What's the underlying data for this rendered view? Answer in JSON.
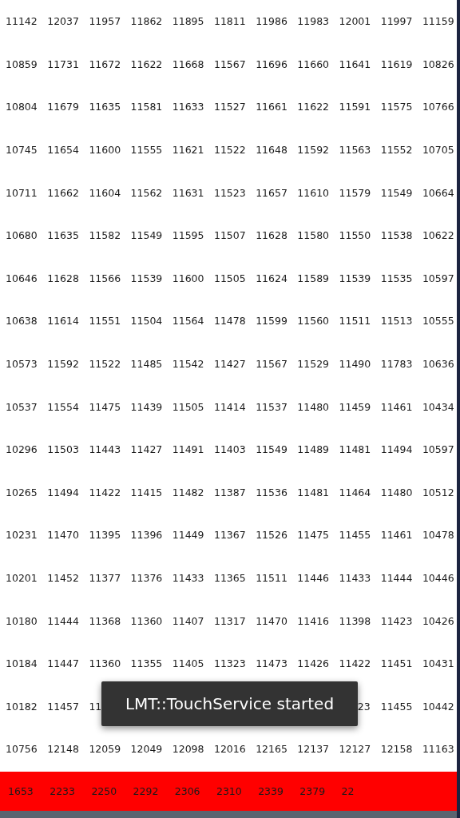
{
  "rows": [
    {
      "kind": "full",
      "cells": [
        "11142",
        "12037",
        "11957",
        "11862",
        "11895",
        "11811",
        "11986",
        "11983",
        "12001",
        "11997",
        "11159"
      ]
    },
    {
      "kind": "full",
      "cells": [
        "10859",
        "11731",
        "11672",
        "11622",
        "11668",
        "11567",
        "11696",
        "11660",
        "11641",
        "11619",
        "10826"
      ]
    },
    {
      "kind": "full",
      "cells": [
        "10804",
        "11679",
        "11635",
        "11581",
        "11633",
        "11527",
        "11661",
        "11622",
        "11591",
        "11575",
        "10766"
      ]
    },
    {
      "kind": "full",
      "cells": [
        "10745",
        "11654",
        "11600",
        "11555",
        "11621",
        "11522",
        "11648",
        "11592",
        "11563",
        "11552",
        "10705"
      ]
    },
    {
      "kind": "full",
      "cells": [
        "10711",
        "11662",
        "11604",
        "11562",
        "11631",
        "11523",
        "11657",
        "11610",
        "11579",
        "11549",
        "10664"
      ]
    },
    {
      "kind": "full",
      "cells": [
        "10680",
        "11635",
        "11582",
        "11549",
        "11595",
        "11507",
        "11628",
        "11580",
        "11550",
        "11538",
        "10622"
      ]
    },
    {
      "kind": "full",
      "cells": [
        "10646",
        "11628",
        "11566",
        "11539",
        "11600",
        "11505",
        "11624",
        "11589",
        "11539",
        "11535",
        "10597"
      ]
    },
    {
      "kind": "full",
      "cells": [
        "10638",
        "11614",
        "11551",
        "11504",
        "11564",
        "11478",
        "11599",
        "11560",
        "11511",
        "11513",
        "10555"
      ]
    },
    {
      "kind": "full",
      "cells": [
        "10573",
        "11592",
        "11522",
        "11485",
        "11542",
        "11427",
        "11567",
        "11529",
        "11490",
        "11783",
        "10636"
      ]
    },
    {
      "kind": "full",
      "cells": [
        "10537",
        "11554",
        "11475",
        "11439",
        "11505",
        "11414",
        "11537",
        "11480",
        "11459",
        "11461",
        "10434"
      ]
    },
    {
      "kind": "full",
      "cells": [
        "10296",
        "11503",
        "11443",
        "11427",
        "11491",
        "11403",
        "11549",
        "11489",
        "11481",
        "11494",
        "10597"
      ]
    },
    {
      "kind": "full",
      "cells": [
        "10265",
        "11494",
        "11422",
        "11415",
        "11482",
        "11387",
        "11536",
        "11481",
        "11464",
        "11480",
        "10512"
      ]
    },
    {
      "kind": "full",
      "cells": [
        "10231",
        "11470",
        "11395",
        "11396",
        "11449",
        "11367",
        "11526",
        "11475",
        "11455",
        "11461",
        "10478"
      ]
    },
    {
      "kind": "full",
      "cells": [
        "10201",
        "11452",
        "11377",
        "11376",
        "11433",
        "11365",
        "11511",
        "11446",
        "11433",
        "11444",
        "10446"
      ]
    },
    {
      "kind": "full",
      "cells": [
        "10180",
        "11444",
        "11368",
        "11360",
        "11407",
        "11317",
        "11470",
        "11416",
        "11398",
        "11423",
        "10426"
      ]
    },
    {
      "kind": "full",
      "cells": [
        "10184",
        "11447",
        "11360",
        "11355",
        "11405",
        "11323",
        "11473",
        "11426",
        "11422",
        "11451",
        "10431"
      ]
    },
    {
      "kind": "covered",
      "cells_before": [
        "10182",
        "11457",
        "11"
      ],
      "cells_after": [
        "23",
        "11455",
        "10442"
      ]
    },
    {
      "kind": "full",
      "cells": [
        "10756",
        "12148",
        "12059",
        "12049",
        "12098",
        "12016",
        "12165",
        "12137",
        "12127",
        "12158",
        "11163"
      ]
    }
  ],
  "bottom_bar": {
    "cells": [
      "1653",
      "2233",
      "2250",
      "2292",
      "2306",
      "2310",
      "2339",
      "2379",
      "22"
    ]
  },
  "toast": {
    "text": "LMT::TouchService started"
  }
}
